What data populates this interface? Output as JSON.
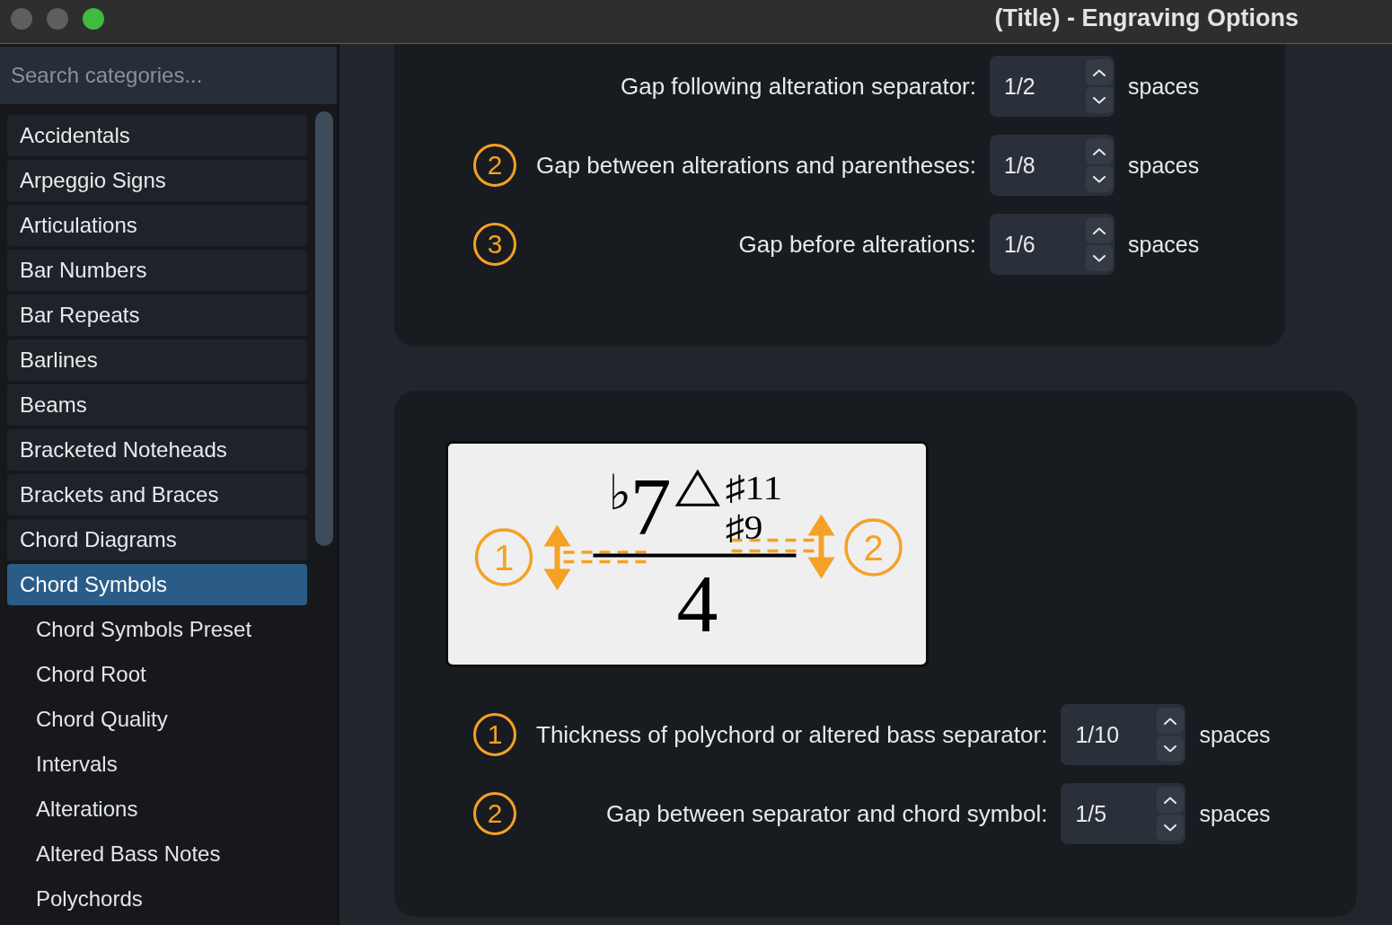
{
  "window": {
    "title": "(Title) - Engraving Options",
    "controls": [
      {
        "kind": "close",
        "disabled": true
      },
      {
        "kind": "minimize",
        "disabled": true
      },
      {
        "kind": "zoom",
        "disabled": false
      }
    ]
  },
  "sidebar": {
    "search": {
      "placeholder": "Search categories..."
    },
    "items": [
      {
        "label": "Accidentals",
        "selected": false
      },
      {
        "label": "Arpeggio Signs",
        "selected": false
      },
      {
        "label": "Articulations",
        "selected": false
      },
      {
        "label": "Bar Numbers",
        "selected": false
      },
      {
        "label": "Bar Repeats",
        "selected": false
      },
      {
        "label": "Barlines",
        "selected": false
      },
      {
        "label": "Beams",
        "selected": false
      },
      {
        "label": "Bracketed Noteheads",
        "selected": false
      },
      {
        "label": "Brackets and Braces",
        "selected": false
      },
      {
        "label": "Chord Diagrams",
        "selected": false
      },
      {
        "label": "Chord Symbols",
        "selected": true,
        "children": [
          {
            "label": "Chord Symbols Preset",
            "selected": false
          },
          {
            "label": "Chord Root",
            "selected": false
          },
          {
            "label": "Chord Quality",
            "selected": false
          },
          {
            "label": "Intervals",
            "selected": false
          },
          {
            "label": "Alterations",
            "selected": false
          },
          {
            "label": "Altered Bass Notes",
            "selected": false
          },
          {
            "label": "Polychords",
            "selected": false
          }
        ]
      }
    ]
  },
  "sections": [
    {
      "rows": [
        {
          "label": "Gap following alteration separator:",
          "value": "1/2",
          "unit": "spaces"
        },
        {
          "marker": "2",
          "label": "Gap between alterations and parentheses:",
          "value": "1/8",
          "unit": "spaces"
        },
        {
          "marker": "3",
          "label": "Gap before alterations:",
          "value": "1/6",
          "unit": "spaces"
        }
      ]
    },
    {
      "preview": {
        "flat": "♭",
        "root": "7",
        "quality": "△",
        "upper_alteration": "♯11",
        "lower_alteration": "♯9",
        "bass": "4",
        "left_callout": "1",
        "right_callout": "2"
      },
      "rows": [
        {
          "marker": "1",
          "label": "Thickness of polychord or altered bass separator:",
          "value": "1/10",
          "unit": "spaces"
        },
        {
          "marker": "2",
          "label": "Gap between separator and chord symbol:",
          "value": "1/5",
          "unit": "spaces"
        }
      ]
    }
  ]
}
